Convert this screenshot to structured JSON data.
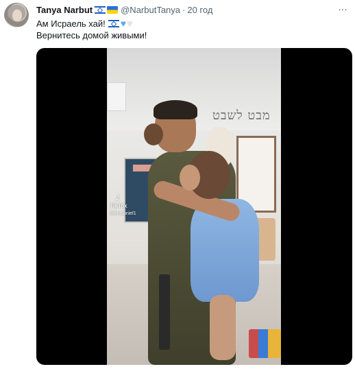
{
  "tweet": {
    "author": {
      "display_name": "Tanya Narbut",
      "handle": "@NarbutTanya",
      "name_flags": [
        "israel-flag",
        "ukraine-flag"
      ],
      "avatar": "user-avatar"
    },
    "separator": "·",
    "timestamp": "20 год",
    "more_icon": "…",
    "text_line_1": "Ам Исраель хай!",
    "text_line_1_emojis": [
      "israel-flag",
      "blue-heart",
      "white-heart"
    ],
    "text_line_2": "Вернитесь домой живыми!"
  },
  "media": {
    "type": "video",
    "watermark": {
      "brand": "TikTok",
      "user": "@chelaniel1",
      "icon": "tiktok-icon"
    },
    "scene_text": "מבט לשבט"
  },
  "colors": {
    "text_primary": "#0f1419",
    "text_secondary": "#536471",
    "media_background": "#000000",
    "heart_blue": "#5aa9e6"
  }
}
